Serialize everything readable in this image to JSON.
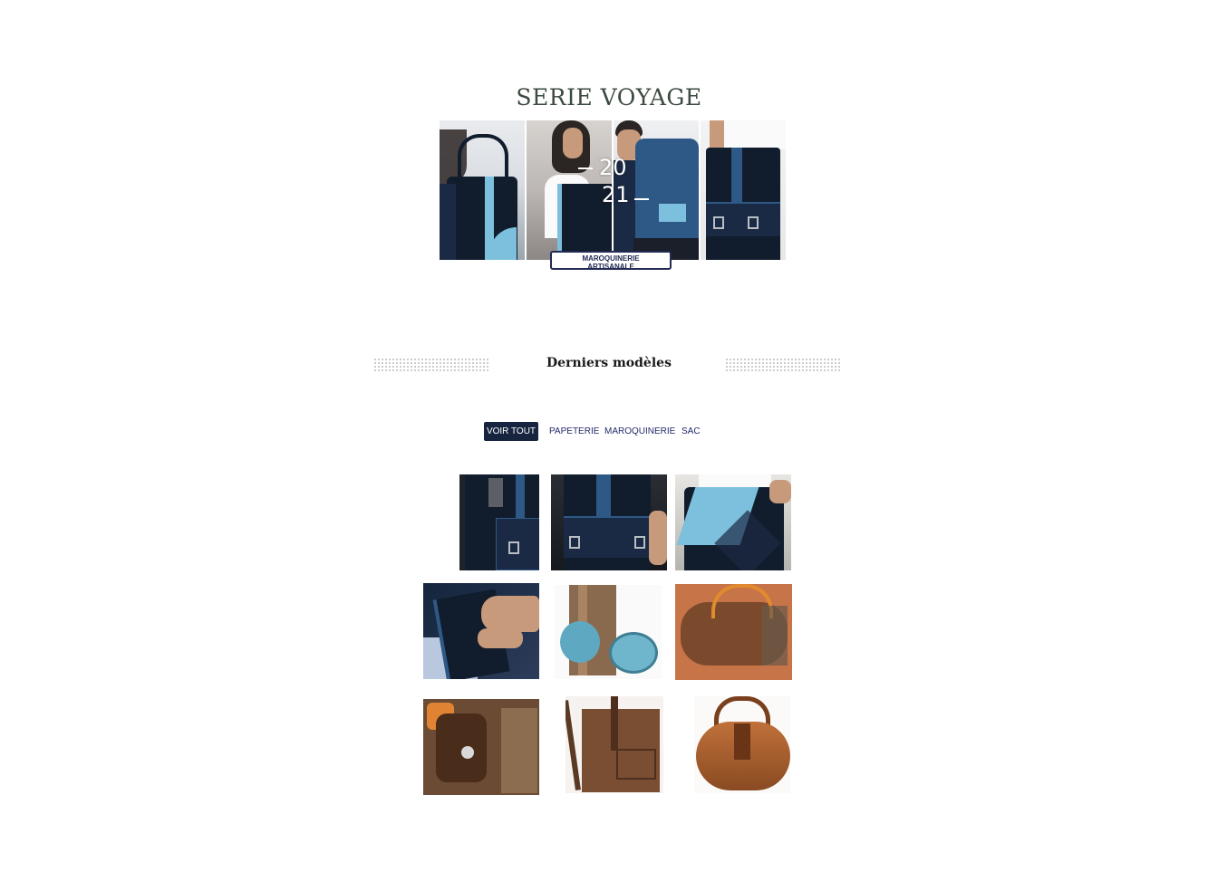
{
  "hero": {
    "title": "SERIE VOYAGE",
    "year_top": "20",
    "year_bottom": "21",
    "badge_line1": "MAROQUINERIE",
    "badge_line2": "ARTISANALE"
  },
  "section": {
    "title": "Derniers modèles"
  },
  "filters": {
    "tabs": [
      {
        "label": "VOIR TOUT",
        "active": true
      },
      {
        "label": "PAPETERIE",
        "active": false
      },
      {
        "label": "MAROQUINERIE",
        "active": false
      },
      {
        "label": "SAC",
        "active": false
      }
    ]
  },
  "products": {
    "count_visible": 9
  },
  "colors": {
    "title_green": "#3c4a40",
    "navy": "#16243f",
    "tab_text": "#232a6a",
    "badge_border": "#232a54"
  }
}
